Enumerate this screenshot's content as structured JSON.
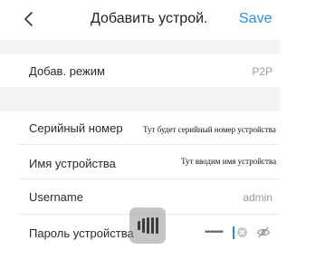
{
  "header": {
    "back_icon": "chevron-left-icon",
    "title": "Добавить устрой...",
    "save_label": "Save"
  },
  "form": {
    "mode": {
      "label": "Добав. режим",
      "value": "P2P"
    },
    "serial": {
      "label": "Серийный номер",
      "annotation": "Тут будет серийный номер устройства"
    },
    "device_name": {
      "label": "Имя устройства",
      "annotation": "Тут вводим имя устройства"
    },
    "username": {
      "label": "Username",
      "value": "admin"
    },
    "password": {
      "label": "Пароль устройства",
      "masked_value": "••••••••"
    }
  },
  "icons": {
    "clear": "clear-circle-icon",
    "visibility": "eye-off-icon",
    "voice": "voice-bars-icon"
  },
  "colors": {
    "accent": "#2b8fe0",
    "separator": "#f3f3f3",
    "text": "#2a2a2a",
    "muted": "#9a9a9a"
  }
}
